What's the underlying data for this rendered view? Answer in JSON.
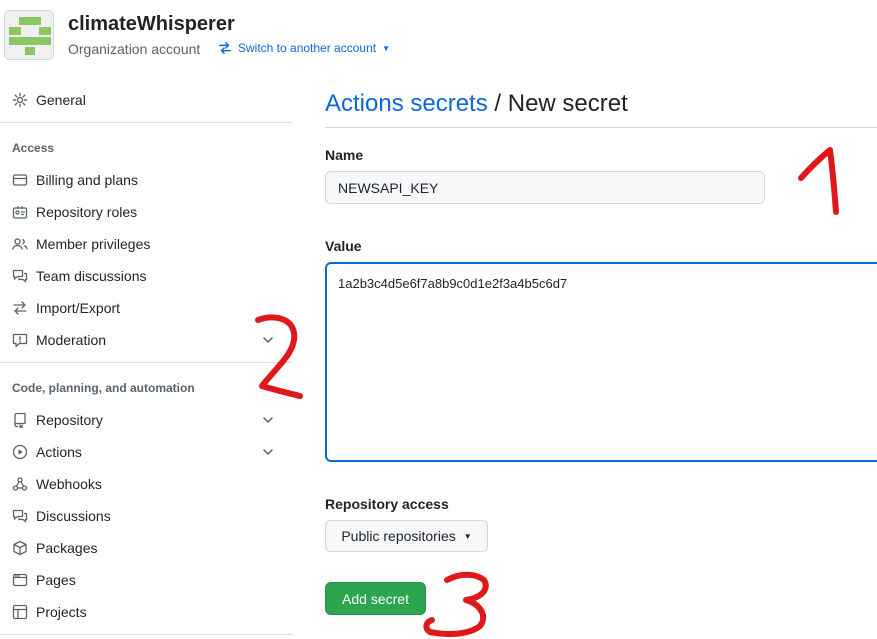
{
  "header": {
    "org_name": "climateWhisperer",
    "org_type": "Organization account",
    "switch_label": "Switch to another account"
  },
  "sidebar": {
    "general": "General",
    "sections": [
      {
        "title": "Access",
        "items": [
          "Billing and plans",
          "Repository roles",
          "Member privileges",
          "Team discussions",
          "Import/Export",
          "Moderation"
        ]
      },
      {
        "title": "Code, planning, and automation",
        "items": [
          "Repository",
          "Actions",
          "Webhooks",
          "Discussions",
          "Packages",
          "Pages",
          "Projects"
        ]
      }
    ]
  },
  "main": {
    "breadcrumb_link": "Actions secrets",
    "breadcrumb_sep": " / ",
    "breadcrumb_current": "New secret",
    "name_label": "Name",
    "name_value": "NEWSAPI_KEY",
    "value_label": "Value",
    "value_value": "1a2b3c4d5e6f7a8b9c0d1e2f3a4b5c6d7",
    "repo_access_label": "Repository access",
    "repo_access_value": "Public repositories",
    "submit_label": "Add secret"
  },
  "annotations": [
    "1",
    "2",
    "3"
  ],
  "colors": {
    "link": "#0969da",
    "primary_button": "#2da44e",
    "annotation": "#e0171b"
  }
}
